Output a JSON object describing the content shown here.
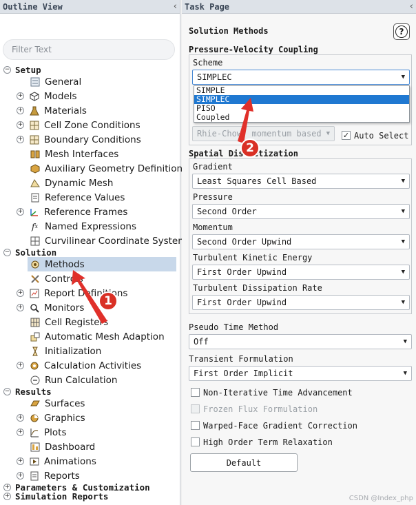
{
  "outline": {
    "title": "Outline View",
    "collapse": "‹",
    "filter_placeholder": "Filter Text",
    "sections": {
      "setup": "Setup",
      "solution": "Solution",
      "results": "Results",
      "params": "Parameters & Customization",
      "reports": "Simulation Reports"
    },
    "items": {
      "general": "General",
      "models": "Models",
      "materials": "Materials",
      "cell_zone": "Cell Zone Conditions",
      "boundary": "Boundary Conditions",
      "mesh_interfaces": "Mesh Interfaces",
      "aux_geom": "Auxiliary Geometry Definitions",
      "dynamic_mesh": "Dynamic Mesh",
      "ref_values": "Reference Values",
      "ref_frames": "Reference Frames",
      "named_expr": "Named Expressions",
      "curvilinear": "Curvilinear Coordinate System",
      "methods": "Methods",
      "controls": "Controls",
      "report_defs": "Report Definitions",
      "monitors": "Monitors",
      "cell_registers": "Cell Registers",
      "auto_mesh": "Automatic Mesh Adaption",
      "initialization": "Initialization",
      "calc_activities": "Calculation Activities",
      "run_calc": "Run Calculation",
      "surfaces": "Surfaces",
      "graphics": "Graphics",
      "plots": "Plots",
      "dashboard": "Dashboard",
      "animations": "Animations",
      "res_reports": "Reports"
    }
  },
  "task": {
    "title": "Task Page",
    "collapse": "‹",
    "heading": "Solution Methods",
    "help": "?",
    "pv_group": "Pressure-Velocity Coupling",
    "scheme_label": "Scheme",
    "scheme_value": "SIMPLEC",
    "scheme_options": [
      "SIMPLE",
      "SIMPLEC",
      "PISO",
      "Coupled"
    ],
    "flux_value": "Rhie-Chow: momentum based",
    "auto_select": "Auto Select",
    "spatial_group": "Spatial Discretization",
    "gradient_label": "Gradient",
    "gradient_value": "Least Squares Cell Based",
    "pressure_label": "Pressure",
    "pressure_value": "Second Order",
    "momentum_label": "Momentum",
    "momentum_value": "Second Order Upwind",
    "tke_label": "Turbulent Kinetic Energy",
    "tke_value": "First Order Upwind",
    "tdr_label": "Turbulent Dissipation Rate",
    "tdr_value": "First Order Upwind",
    "pseudo_label": "Pseudo Time Method",
    "pseudo_value": "Off",
    "transient_label": "Transient Formulation",
    "transient_value": "First Order Implicit",
    "check_noniter": "Non-Iterative Time Advancement",
    "check_frozen": "Frozen Flux Formulation",
    "check_warped": "Warped-Face Gradient Correction",
    "check_highorder": "High Order Term Relaxation",
    "default_btn": "Default"
  },
  "annotations": {
    "badge1": "1",
    "badge2": "2",
    "arrow_color": "#d93025"
  },
  "watermark": "CSDN @Index_php"
}
